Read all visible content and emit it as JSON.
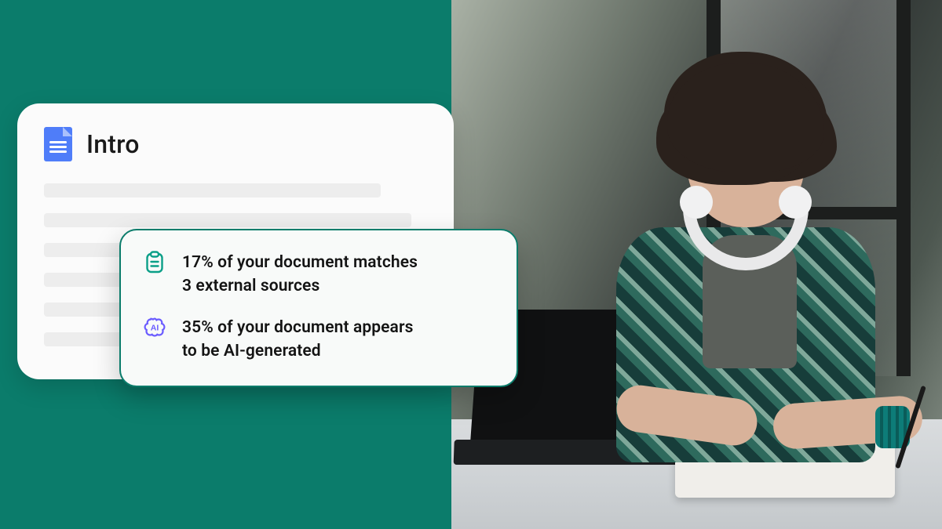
{
  "document": {
    "title": "Intro",
    "icon": "google-doc"
  },
  "insights": {
    "plagiarism": {
      "icon": "clipboard-icon",
      "line1": "17% of your document matches",
      "line2": "3 external sources",
      "match_percent": 17,
      "external_source_count": 3
    },
    "ai": {
      "icon": "ai-brain-icon",
      "line1": "35% of your document appears",
      "line2": "to be AI-generated",
      "ai_percent": 35
    }
  },
  "colors": {
    "brand_teal": "#0b7c6b",
    "doc_blue": "#4f7df9",
    "ai_purple": "#6b5cff"
  }
}
